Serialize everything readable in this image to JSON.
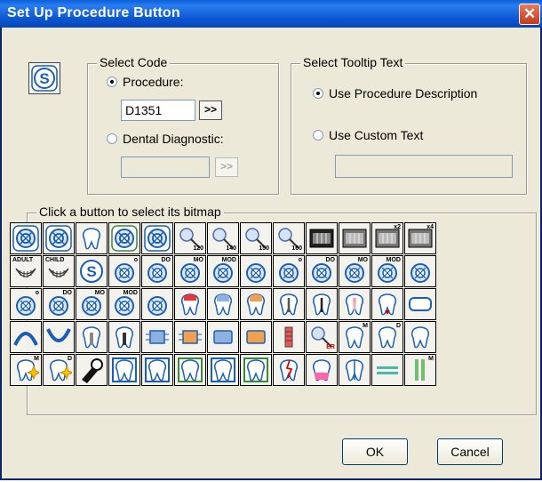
{
  "window": {
    "title": "Set Up Procedure Button"
  },
  "select_code": {
    "legend": "Select Code",
    "procedure_label": "Procedure:",
    "procedure_value": "D1351",
    "lookup_label": ">>",
    "diagnostic_label": "Dental Diagnostic:",
    "diagnostic_value": "",
    "diagnostic_lookup_label": ">>"
  },
  "tooltip": {
    "legend": "Select Tooltip Text",
    "use_desc_label": "Use Procedure Description",
    "use_custom_label": "Use Custom Text",
    "custom_value": ""
  },
  "bitmap": {
    "legend": "Click a button to select its bitmap",
    "rows": [
      [
        {
          "icon": "ring"
        },
        {
          "icon": "ring"
        },
        {
          "icon": "tooth"
        },
        {
          "icon": "ring-green"
        },
        {
          "icon": "ring"
        },
        {
          "icon": "probe",
          "label": "120"
        },
        {
          "icon": "probe",
          "label": "140"
        },
        {
          "icon": "probe",
          "label": "150"
        },
        {
          "icon": "probe",
          "label": "160"
        },
        {
          "icon": "xray"
        },
        {
          "icon": "xray-gray"
        },
        {
          "icon": "xray-x2",
          "label": "x2"
        },
        {
          "icon": "xray-x4",
          "label": "x4"
        }
      ],
      [
        {
          "icon": "smile",
          "label": "ADULT"
        },
        {
          "icon": "smile",
          "label": "CHILD"
        },
        {
          "icon": "s-circle"
        },
        {
          "icon": "ring-small",
          "label": "o"
        },
        {
          "icon": "ring-small",
          "label": "DO"
        },
        {
          "icon": "ring-small",
          "label": "MO"
        },
        {
          "icon": "ring-small",
          "label": "MOD"
        },
        {
          "icon": "ring-small"
        },
        {
          "icon": "ring-small",
          "label": "o"
        },
        {
          "icon": "ring-small",
          "label": "DO"
        },
        {
          "icon": "ring-small",
          "label": "MO"
        },
        {
          "icon": "ring-small",
          "label": "MOD"
        },
        {
          "icon": "ring-small"
        }
      ],
      [
        {
          "icon": "ring-small",
          "label": "o"
        },
        {
          "icon": "ring-small",
          "label": "DO"
        },
        {
          "icon": "ring-small",
          "label": "MO"
        },
        {
          "icon": "ring-small",
          "label": "MOD"
        },
        {
          "icon": "ring-small"
        },
        {
          "icon": "tooth-red"
        },
        {
          "icon": "tooth-blue"
        },
        {
          "icon": "tooth-orange"
        },
        {
          "icon": "tooth-root"
        },
        {
          "icon": "tooth-root-dark"
        },
        {
          "icon": "tooth-pink"
        },
        {
          "icon": "tooth-arrow"
        },
        {
          "icon": "rounded-rect"
        }
      ],
      [
        {
          "icon": "arch-upper"
        },
        {
          "icon": "arch-lower"
        },
        {
          "icon": "tooth-post"
        },
        {
          "icon": "tooth-post-dark"
        },
        {
          "icon": "bridge-blue"
        },
        {
          "icon": "bridge-orange"
        },
        {
          "icon": "pontic-blue"
        },
        {
          "icon": "pontic-orange"
        },
        {
          "icon": "tooth-implant"
        },
        {
          "icon": "probe-er",
          "label": "ER"
        },
        {
          "icon": "tooth-m",
          "label": "M"
        },
        {
          "icon": "tooth-d",
          "label": "D"
        },
        {
          "icon": "tooth-plain"
        }
      ],
      [
        {
          "icon": "tooth-star",
          "label": "M"
        },
        {
          "icon": "tooth-star",
          "label": "D"
        },
        {
          "icon": "flashlight"
        },
        {
          "icon": "tooth-frame"
        },
        {
          "icon": "tooth-frame"
        },
        {
          "icon": "tooth-frame-green"
        },
        {
          "icon": "tooth-frame"
        },
        {
          "icon": "tooth-frame-green"
        },
        {
          "icon": "tooth-fracture"
        },
        {
          "icon": "tooth-crown-red"
        },
        {
          "icon": "tooth-split"
        },
        {
          "icon": "bars-teal"
        },
        {
          "icon": "bars-green",
          "label": "M"
        },
        {
          "icon": "bars-green",
          "label": "D"
        }
      ]
    ]
  },
  "buttons": {
    "ok": "OK",
    "cancel": "Cancel"
  }
}
